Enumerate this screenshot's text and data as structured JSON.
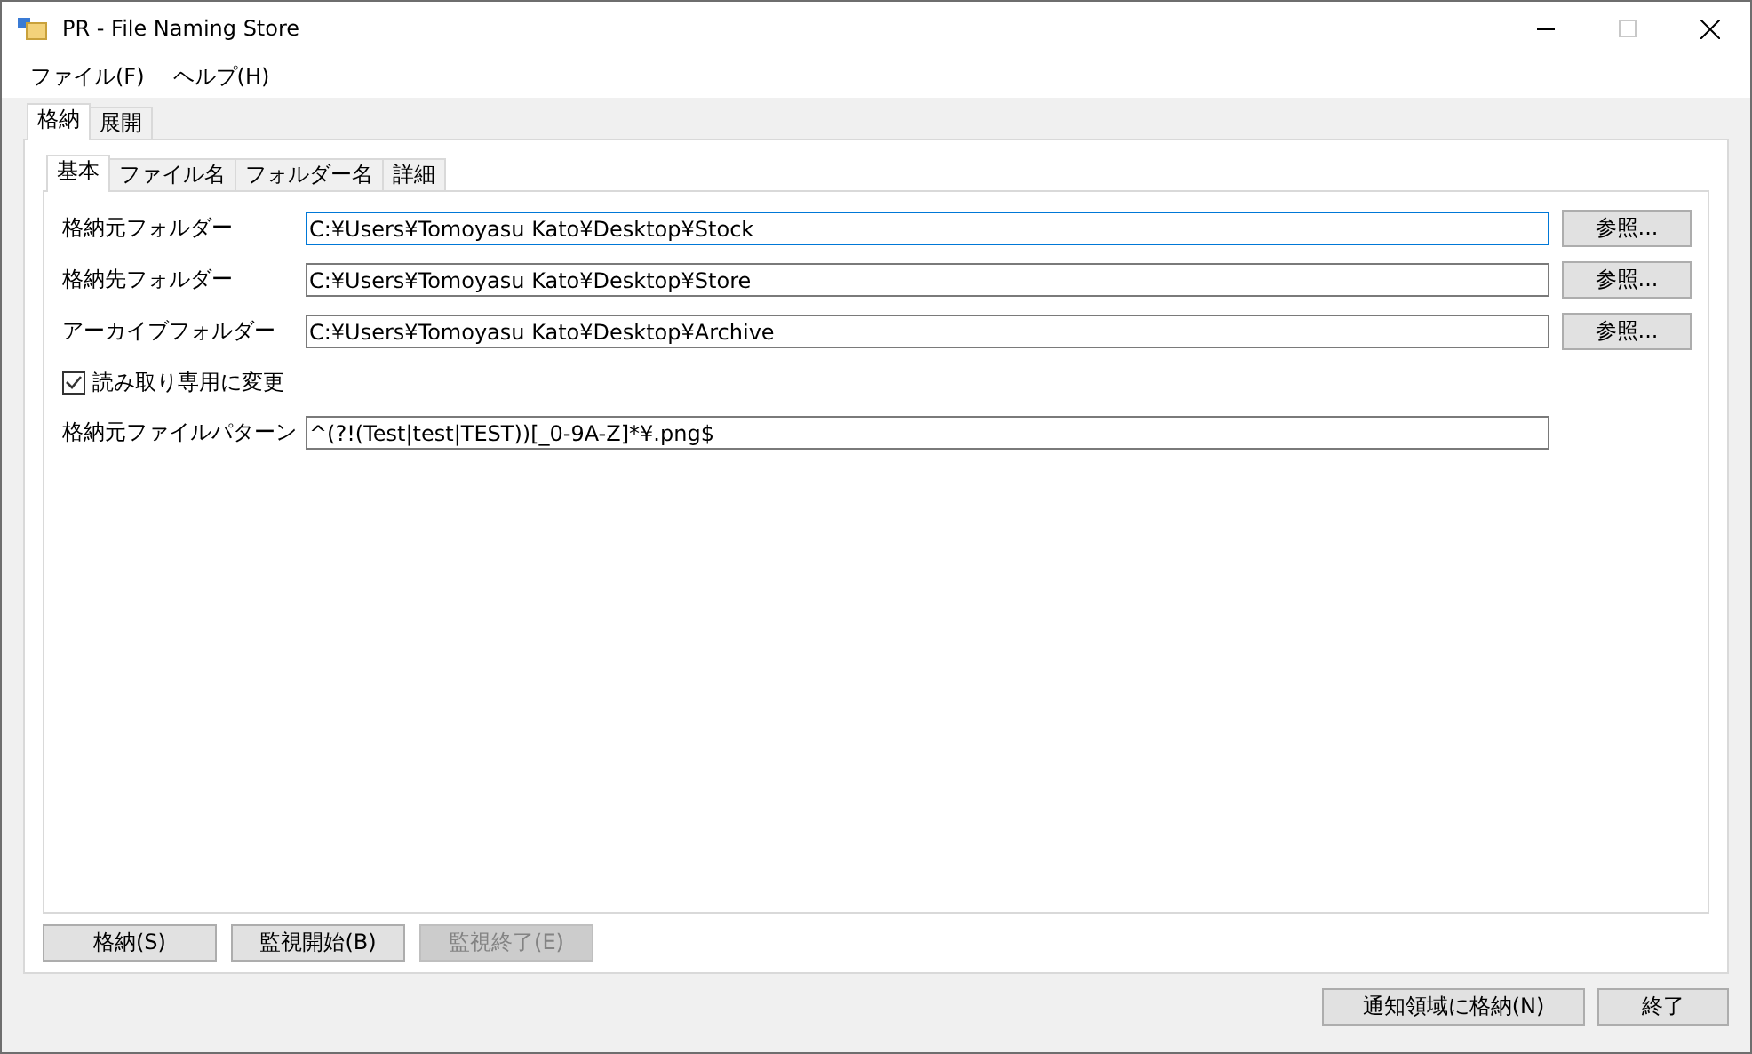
{
  "window": {
    "title": "PR - File Naming Store",
    "maximize_disabled": true
  },
  "menu": [
    "ファイル(F)",
    "ヘルプ(H)"
  ],
  "outer_tabs": [
    {
      "label": "格納",
      "selected": true
    },
    {
      "label": "展開",
      "selected": false
    }
  ],
  "inner_tabs": [
    {
      "label": "基本",
      "selected": true
    },
    {
      "label": "ファイル名",
      "selected": false
    },
    {
      "label": "フォルダー名",
      "selected": false
    },
    {
      "label": "詳細",
      "selected": false
    }
  ],
  "fields": [
    {
      "kind": "folder",
      "label": "格納元フォルダー",
      "value": "C:¥Users¥Tomoyasu Kato¥Desktop¥Stock",
      "focused": true,
      "button": "参照..."
    },
    {
      "kind": "folder",
      "label": "格納先フォルダー",
      "value": "C:¥Users¥Tomoyasu Kato¥Desktop¥Store",
      "focused": false,
      "button": "参照..."
    },
    {
      "kind": "folder",
      "label": "アーカイブフォルダー",
      "value": "C:¥Users¥Tomoyasu Kato¥Desktop¥Archive",
      "focused": false,
      "button": "参照..."
    },
    {
      "kind": "checkbox",
      "label": "読み取り専用に変更",
      "checked": true
    },
    {
      "kind": "text",
      "label": "格納元ファイルパターン",
      "value": "^(?!(Test|test|TEST))[_0-9A-Z]*¥.png$",
      "focused": false
    }
  ],
  "action_buttons": [
    {
      "label": "格納(S)",
      "disabled": false
    },
    {
      "label": "監視開始(B)",
      "disabled": false
    },
    {
      "label": "監視終了(E)",
      "disabled": true
    }
  ],
  "footer_buttons": [
    {
      "label": "通知領域に格納(N)",
      "disabled": false
    },
    {
      "label": "終了",
      "disabled": false
    }
  ]
}
